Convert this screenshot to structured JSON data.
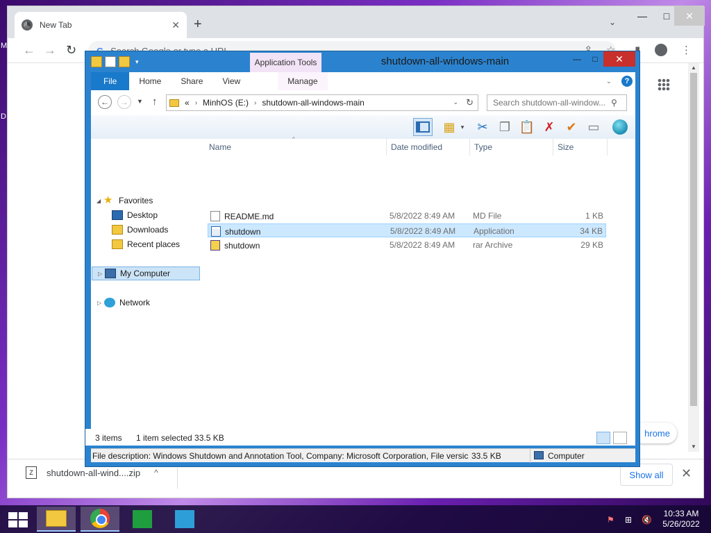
{
  "desktop": {
    "edge_fragments": [
      "M",
      "D"
    ]
  },
  "chrome": {
    "tab_title": "New Tab",
    "tab_close": "✕",
    "new_tab": "+",
    "tab_search": "⌄",
    "window": {
      "minimize": "—",
      "maximize": "□",
      "close": "✕"
    },
    "nav": {
      "back": "←",
      "forward": "→",
      "reload": "↻"
    },
    "omnibox_placeholder": "Search Google or type a URL",
    "omnibox_g": "G",
    "toolbar_icons": {
      "share": "⇪",
      "star": "☆",
      "side_panel": "▮",
      "menu": "⋮"
    },
    "customize_label": "hrome",
    "download": {
      "file_name": "shutdown-all-wind....zip",
      "file_icon": "Z",
      "chevron": "^",
      "show_all": "Show all",
      "close": "✕"
    }
  },
  "explorer": {
    "title": "shutdown-all-windows-main",
    "app_tools_tab": "Application Tools",
    "qat_dropdown": "▾",
    "window": {
      "minimize": "—",
      "maximize": "□",
      "close": "✕"
    },
    "ribbon_tabs": [
      "File",
      "Home",
      "Share",
      "View",
      "Manage"
    ],
    "ribbon_chevron": "⌄",
    "help": "?",
    "address": {
      "back": "←",
      "forward": "→",
      "recent": "▼",
      "up": "↑",
      "overflow": "«",
      "crumb_sep": "›",
      "crumbs": [
        "MinhOS (E:)",
        "shutdown-all-windows-main"
      ],
      "dropdown": "⌄",
      "refresh": "↻"
    },
    "search_placeholder": "Search shutdown-all-window...",
    "search_icon": "⚲",
    "commands": {
      "views": "▦",
      "views_drop": "▾",
      "cut": "✂",
      "copy": "❐",
      "paste": "📋",
      "delete": "✗",
      "check": "✔",
      "rename": "▭"
    },
    "nav_pane": {
      "arrows": {
        "expanded": "◢",
        "collapsed": "▷"
      },
      "favorites": "Favorites",
      "favorites_star": "★",
      "items": [
        "Desktop",
        "Downloads",
        "Recent places"
      ],
      "my_computer": "My Computer",
      "network": "Network"
    },
    "columns": {
      "name": "Name",
      "date": "Date modified",
      "type": "Type",
      "size": "Size"
    },
    "sort_indicator": "^",
    "files": [
      {
        "name": "README.md",
        "date": "5/8/2022 8:49 AM",
        "type": "MD File",
        "size": "1 KB",
        "selected": false,
        "icon": "document-icon"
      },
      {
        "name": "shutdown",
        "date": "5/8/2022 8:49 AM",
        "type": "Application",
        "size": "34 KB",
        "selected": true,
        "icon": "application-icon"
      },
      {
        "name": "shutdown",
        "date": "5/8/2022 8:49 AM",
        "type": "rar Archive",
        "size": "29 KB",
        "selected": false,
        "icon": "rar-archive-icon"
      }
    ],
    "status": {
      "items": "3 items",
      "selected": "1 item selected  33.5 KB"
    },
    "details_bar": {
      "description": "File description: Windows Shutdown and Annotation Tool, Company: Microsoft Corporation, File versic",
      "size": "33.5 KB",
      "computer": "Computer"
    }
  },
  "taskbar": {
    "tray": {
      "flag": "⚑",
      "network": "⊞",
      "volume": "🔇"
    },
    "time": "10:33 AM",
    "date": "5/26/2022"
  },
  "colors": {
    "explorer_frame": "#2b83cf",
    "file_tab": "#1979ca",
    "close_red": "#c7302b",
    "selection": "#cce8ff",
    "app_tools_tab": "#f2e3f6"
  }
}
